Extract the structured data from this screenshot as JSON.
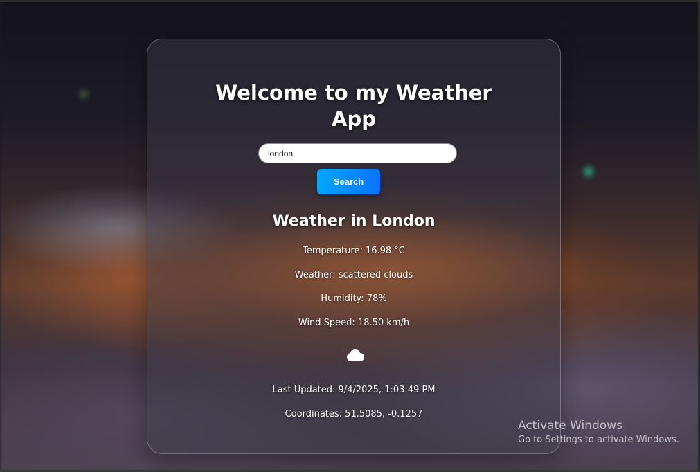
{
  "app": {
    "title": "Welcome to my Weather App"
  },
  "search": {
    "value": "london",
    "button_label": "Search"
  },
  "weather": {
    "heading": "Weather in London",
    "temperature": "Temperature: 16.98 °C",
    "description": "Weather: scattered clouds",
    "humidity": "Humidity: 78%",
    "wind_speed": "Wind Speed: 18.50 km/h",
    "icon": "cloud-icon",
    "last_updated": "Last Updated: 9/4/2025, 1:03:49 PM",
    "coordinates": "Coordinates: 51.5085, -0.1257"
  },
  "watermark": {
    "title": "Activate Windows",
    "subtitle": "Go to Settings to activate Windows."
  },
  "colors": {
    "button_start": "#00a7ff",
    "button_end": "#0a72ff",
    "text": "#ffffff"
  }
}
